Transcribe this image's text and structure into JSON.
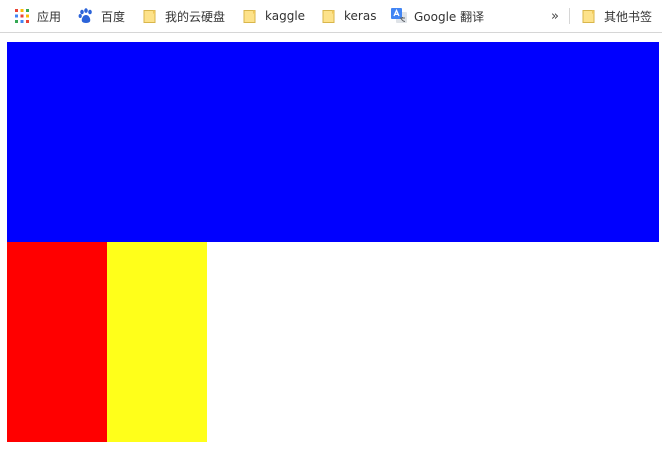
{
  "bookmarks_bar": {
    "items": [
      {
        "label": "应用",
        "icon": "apps-grid-icon"
      },
      {
        "label": "百度",
        "icon": "baidu-paw-icon"
      },
      {
        "label": "我的云硬盘",
        "icon": "folder-icon"
      },
      {
        "label": "kaggle",
        "icon": "folder-icon"
      },
      {
        "label": "keras",
        "icon": "folder-icon"
      },
      {
        "label": "Google 翻译",
        "icon": "google-translate-icon"
      }
    ],
    "overflow_label": "»",
    "other_bookmarks": {
      "label": "其他书签",
      "icon": "folder-icon"
    }
  },
  "page": {
    "blocks": [
      {
        "name": "blue",
        "color": "#0000ff"
      },
      {
        "name": "red",
        "color": "#ff0000"
      },
      {
        "name": "yellow",
        "color": "#ffff1a"
      }
    ]
  }
}
